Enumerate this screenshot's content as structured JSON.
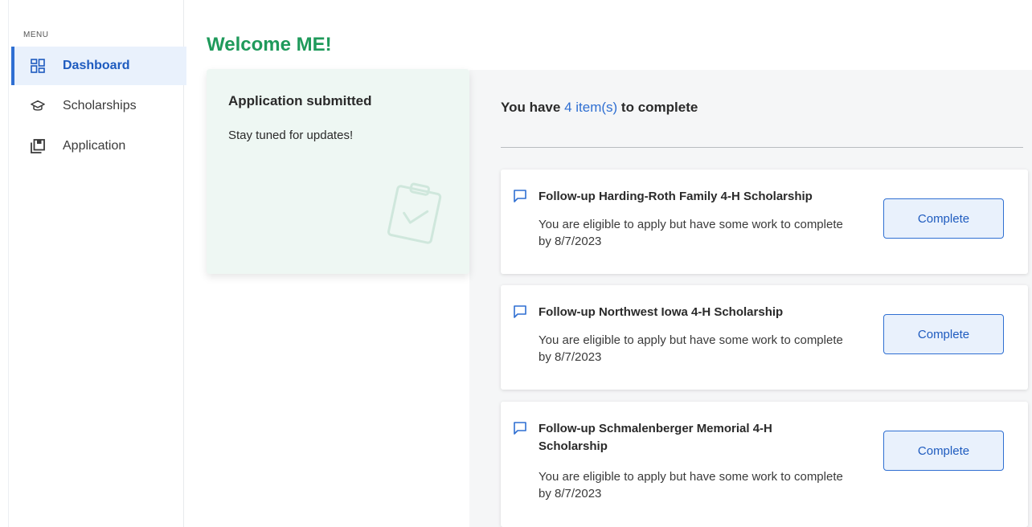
{
  "sidebar": {
    "menu_label": "MENU",
    "items": [
      {
        "label": "Dashboard",
        "icon": "dashboard-icon",
        "active": true
      },
      {
        "label": "Scholarships",
        "icon": "graduation-cap-icon",
        "active": false
      },
      {
        "label": "Application",
        "icon": "application-icon",
        "active": false
      }
    ]
  },
  "main": {
    "welcome": "Welcome ME!",
    "status_card": {
      "title": "Application submitted",
      "subtitle": "Stay tuned for updates!",
      "icon": "clipboard-check-icon"
    },
    "items_header": {
      "prefix": "You have",
      "count_text": "4 item(s)",
      "suffix": "to complete"
    },
    "tasks": [
      {
        "title": "Follow-up Harding-Roth Family 4-H Scholarship",
        "description": "You are eligible to apply but have some work to complete by 8/7/2023",
        "button": "Complete",
        "icon": "flag-icon"
      },
      {
        "title": "Follow-up Northwest Iowa 4-H Scholarship",
        "description": "You are eligible to apply but have some work to complete by 8/7/2023",
        "button": "Complete",
        "icon": "flag-icon"
      },
      {
        "title": "Follow-up Schmalenberger Memorial 4-H Scholarship",
        "description": "You are eligible to apply but have some work to complete by 8/7/2023",
        "button": "Complete",
        "icon": "flag-icon"
      }
    ]
  },
  "colors": {
    "accent_blue": "#2f6fd2",
    "welcome_green": "#1f9a5b",
    "status_card_bg": "#eef7f3"
  }
}
